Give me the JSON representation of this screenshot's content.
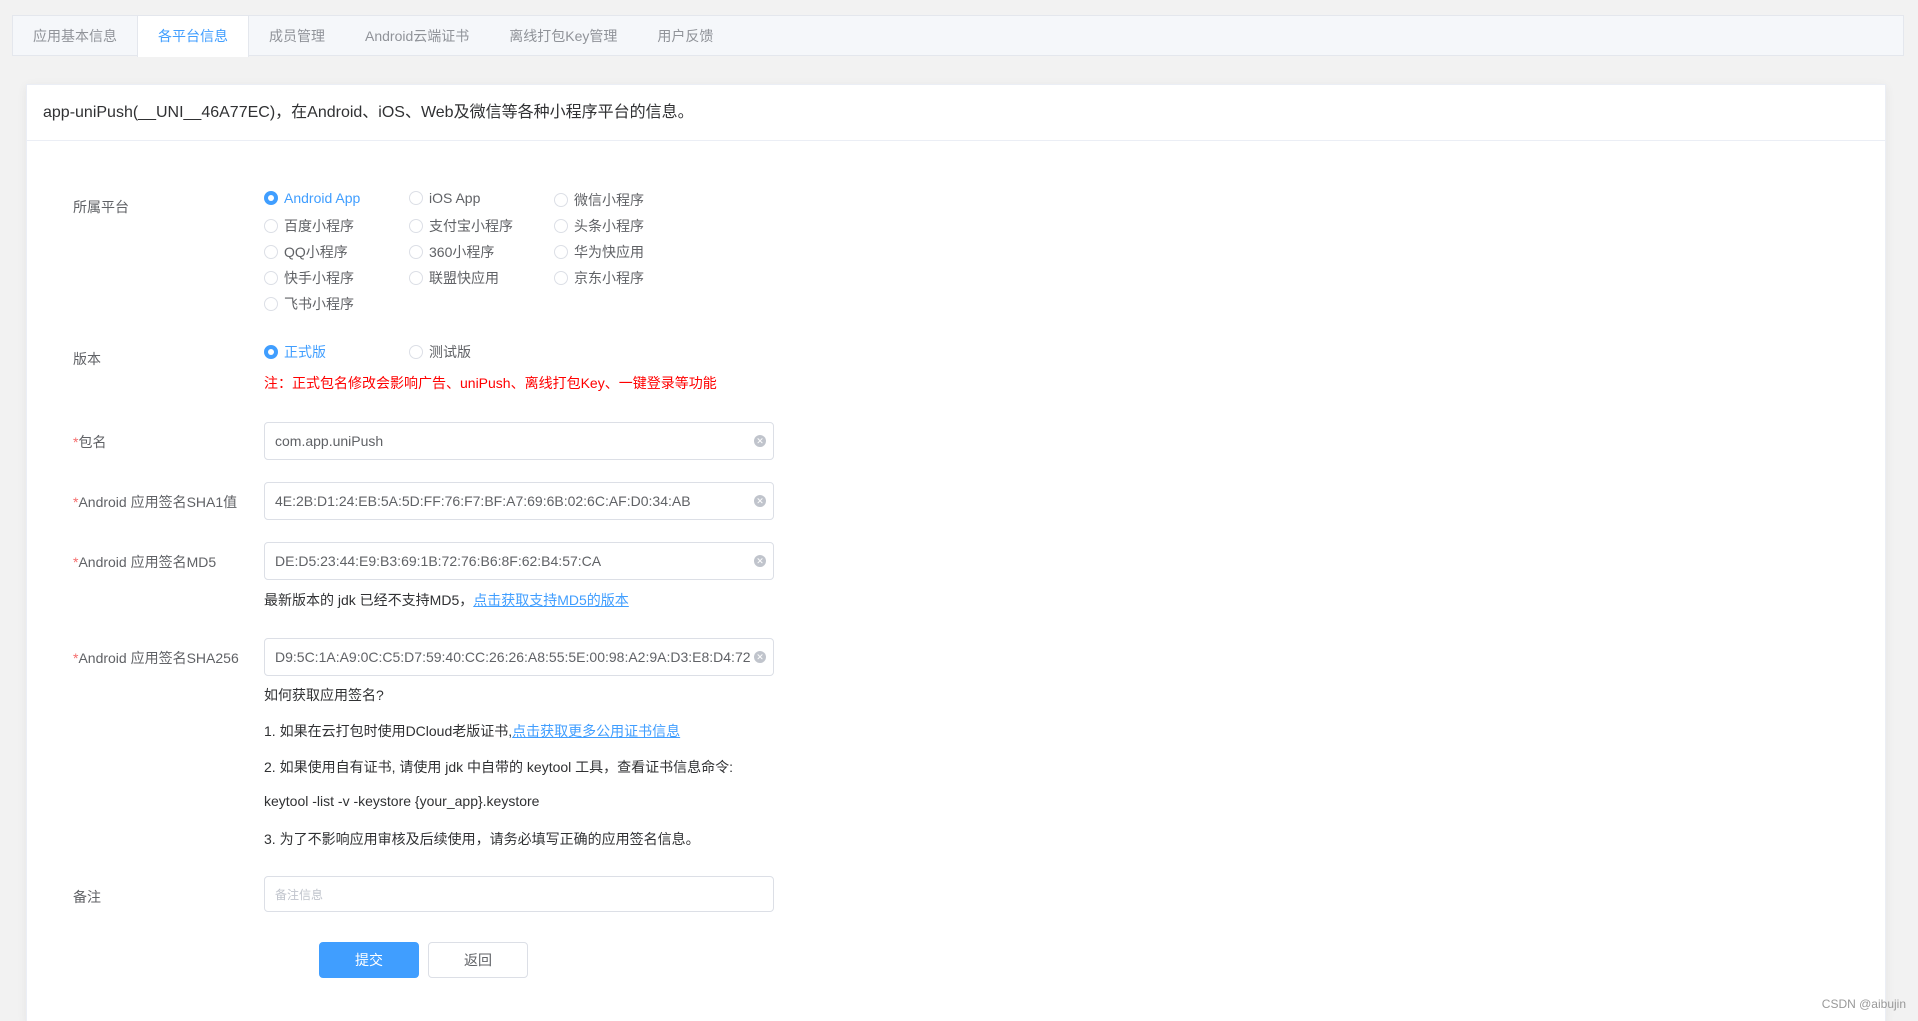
{
  "tabs": [
    {
      "label": "应用基本信息",
      "active": false
    },
    {
      "label": "各平台信息",
      "active": true
    },
    {
      "label": "成员管理",
      "active": false
    },
    {
      "label": "Android云端证书",
      "active": false
    },
    {
      "label": "离线打包Key管理",
      "active": false
    },
    {
      "label": "用户反馈",
      "active": false
    }
  ],
  "card": {
    "header": "app-uniPush(__UNI__46A77EC)，在Android、iOS、Web及微信等各种小程序平台的信息。"
  },
  "platform": {
    "label": "所属平台",
    "options": [
      {
        "label": "Android App",
        "checked": true
      },
      {
        "label": "iOS App",
        "checked": false
      },
      {
        "label": "微信小程序",
        "checked": false
      },
      {
        "label": "百度小程序",
        "checked": false
      },
      {
        "label": "支付宝小程序",
        "checked": false
      },
      {
        "label": "头条小程序",
        "checked": false
      },
      {
        "label": "QQ小程序",
        "checked": false
      },
      {
        "label": "360小程序",
        "checked": false
      },
      {
        "label": "华为快应用",
        "checked": false
      },
      {
        "label": "快手小程序",
        "checked": false
      },
      {
        "label": "联盟快应用",
        "checked": false
      },
      {
        "label": "京东小程序",
        "checked": false
      },
      {
        "label": "飞书小程序",
        "checked": false
      }
    ]
  },
  "version": {
    "label": "版本",
    "options": [
      {
        "label": "正式版",
        "checked": true
      },
      {
        "label": "测试版",
        "checked": false
      }
    ],
    "warning": "注：正式包名修改会影响广告、uniPush、离线打包Key、一键登录等功能"
  },
  "package": {
    "required": "*",
    "label": "包名",
    "value": "com.app.uniPush"
  },
  "sha1": {
    "required": "*",
    "label": "Android 应用签名SHA1值",
    "value": "4E:2B:D1:24:EB:5A:5D:FF:76:F7:BF:A7:69:6B:02:6C:AF:D0:34:AB"
  },
  "md5": {
    "required": "*",
    "label": "Android 应用签名MD5",
    "value": "DE:D5:23:44:E9:B3:69:1B:72:76:B6:8F:62:B4:57:CA",
    "hint": "最新版本的 jdk 已经不支持MD5，",
    "hint_link": "点击获取支持MD5的版本"
  },
  "sha256": {
    "required": "*",
    "label": "Android 应用签名SHA256",
    "value": "D9:5C:1A:A9:0C:C5:D7:59:40:CC:26:26:A8:55:5E:00:98:A2:9A:D3:E8:D4:72"
  },
  "help": {
    "title": "如何获取应用签名?",
    "line1": "1. 如果在云打包时使用DCloud老版证书,",
    "line1_link": "点击获取更多公用证书信息",
    "line2": "2. 如果使用自有证书, 请使用 jdk 中自带的 keytool 工具，查看证书信息命令:",
    "command": "keytool -list -v -keystore {your_app}.keystore",
    "line3": "3. 为了不影响应用审核及后续使用，请务必填写正确的应用签名信息。"
  },
  "remark": {
    "label": "备注",
    "placeholder": "备注信息"
  },
  "buttons": {
    "submit": "提交",
    "back": "返回"
  },
  "watermark": "CSDN @aibujin",
  "colors": {
    "primary": "#409eff",
    "warning": "#ff0000",
    "required": "#f56c6c"
  }
}
